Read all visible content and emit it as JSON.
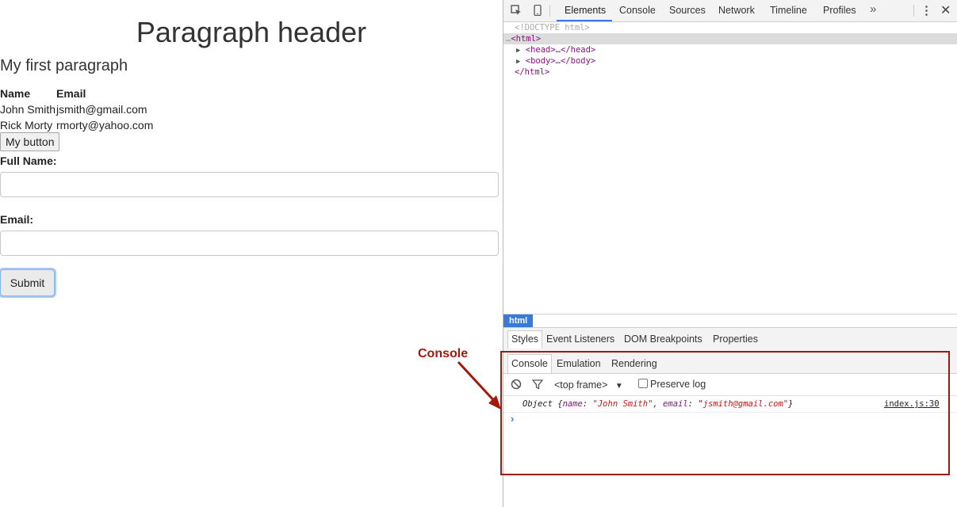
{
  "page": {
    "heading": "Paragraph header",
    "paragraph": "My first paragraph",
    "table": {
      "headers": [
        "Name",
        "Email"
      ],
      "rows": [
        [
          "John Smith",
          "jsmith@gmail.com"
        ],
        [
          "Rick Morty",
          "rmorty@yahoo.com"
        ]
      ]
    },
    "my_button_label": "My button",
    "form": {
      "full_name_label": "Full Name:",
      "full_name_value": "",
      "email_label": "Email:",
      "email_value": "",
      "submit_label": "Submit"
    }
  },
  "annotation": {
    "label": "Console",
    "color": "#a3190b"
  },
  "devtools": {
    "tabs": [
      "Elements",
      "Console",
      "Sources",
      "Network",
      "Timeline",
      "Profiles"
    ],
    "active_tab": "Elements",
    "tree": {
      "doctype": "<!DOCTYPE html>",
      "html_open": "<html>",
      "head": "<head>…</head>",
      "body": "<body>…</body>",
      "html_close": "</html>"
    },
    "breadcrumb": "html",
    "sidebar_tabs": [
      "Styles",
      "Event Listeners",
      "DOM Breakpoints",
      "Properties"
    ],
    "drawer": {
      "tabs": [
        "Console",
        "Emulation",
        "Rendering"
      ],
      "frame": "<top frame>",
      "preserve_log_label": "Preserve log",
      "log": {
        "prefix": "Object {",
        "name_key": "name",
        "name_value": "\"John Smith\"",
        "email_key": "email",
        "email_value": "\"jsmith@gmail.com\"",
        "suffix": "}",
        "source": "index.js:30"
      }
    }
  },
  "colors": {
    "accent": "#3879d9",
    "tag": "#881280",
    "string": "#c41a16",
    "highlight": "#9c1a10"
  }
}
